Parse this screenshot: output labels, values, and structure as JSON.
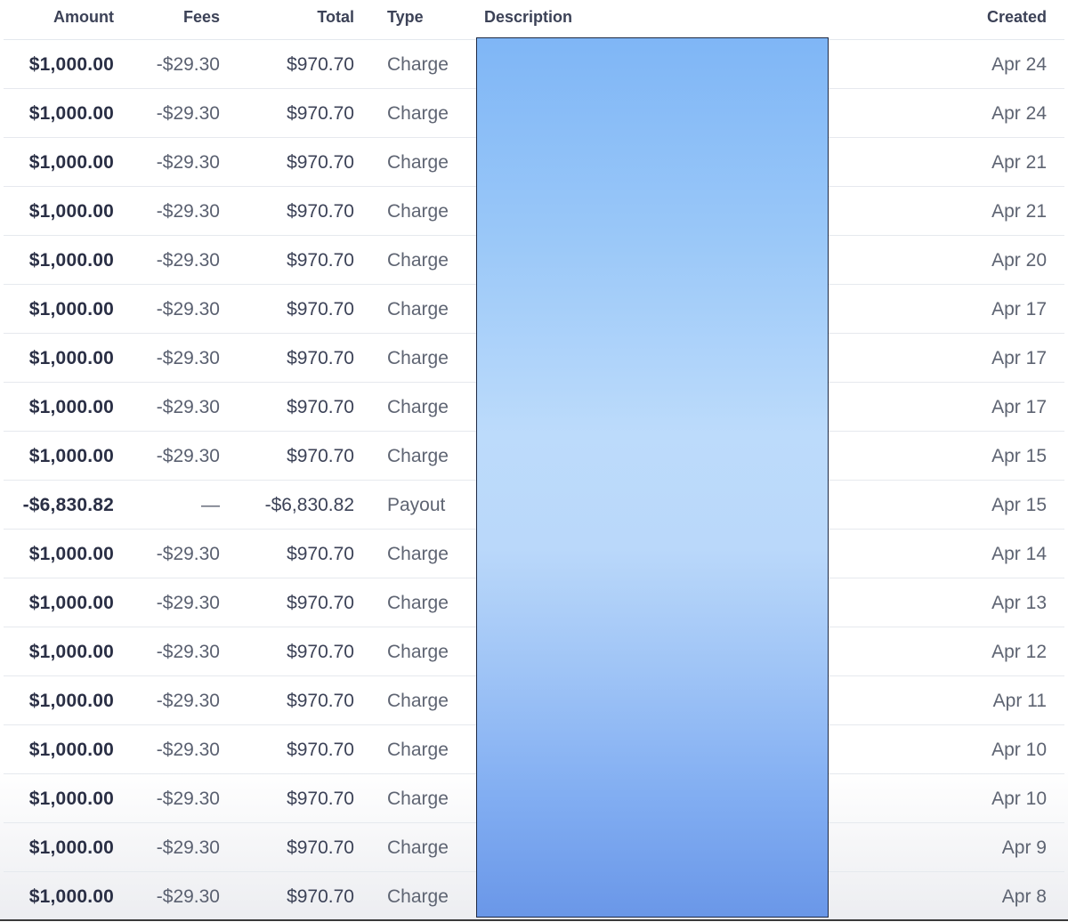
{
  "columns": {
    "amount": "Amount",
    "fees": "Fees",
    "total": "Total",
    "type": "Type",
    "description": "Description",
    "created": "Created"
  },
  "rows": [
    {
      "amount": "$1,000.00",
      "fees": "-$29.30",
      "total": "$970.70",
      "type": "Charge",
      "created": "Apr 24"
    },
    {
      "amount": "$1,000.00",
      "fees": "-$29.30",
      "total": "$970.70",
      "type": "Charge",
      "created": "Apr 24"
    },
    {
      "amount": "$1,000.00",
      "fees": "-$29.30",
      "total": "$970.70",
      "type": "Charge",
      "created": "Apr 21"
    },
    {
      "amount": "$1,000.00",
      "fees": "-$29.30",
      "total": "$970.70",
      "type": "Charge",
      "created": "Apr 21"
    },
    {
      "amount": "$1,000.00",
      "fees": "-$29.30",
      "total": "$970.70",
      "type": "Charge",
      "created": "Apr 20"
    },
    {
      "amount": "$1,000.00",
      "fees": "-$29.30",
      "total": "$970.70",
      "type": "Charge",
      "created": "Apr 17"
    },
    {
      "amount": "$1,000.00",
      "fees": "-$29.30",
      "total": "$970.70",
      "type": "Charge",
      "created": "Apr 17"
    },
    {
      "amount": "$1,000.00",
      "fees": "-$29.30",
      "total": "$970.70",
      "type": "Charge",
      "created": "Apr 17"
    },
    {
      "amount": "$1,000.00",
      "fees": "-$29.30",
      "total": "$970.70",
      "type": "Charge",
      "created": "Apr 15"
    },
    {
      "amount": "-$6,830.82",
      "fees": "—",
      "total": "-$6,830.82",
      "type": "Payout",
      "created": "Apr 15"
    },
    {
      "amount": "$1,000.00",
      "fees": "-$29.30",
      "total": "$970.70",
      "type": "Charge",
      "created": "Apr 14"
    },
    {
      "amount": "$1,000.00",
      "fees": "-$29.30",
      "total": "$970.70",
      "type": "Charge",
      "created": "Apr 13"
    },
    {
      "amount": "$1,000.00",
      "fees": "-$29.30",
      "total": "$970.70",
      "type": "Charge",
      "created": "Apr 12"
    },
    {
      "amount": "$1,000.00",
      "fees": "-$29.30",
      "total": "$970.70",
      "type": "Charge",
      "created": "Apr 11"
    },
    {
      "amount": "$1,000.00",
      "fees": "-$29.30",
      "total": "$970.70",
      "type": "Charge",
      "created": "Apr 10"
    },
    {
      "amount": "$1,000.00",
      "fees": "-$29.30",
      "total": "$970.70",
      "type": "Charge",
      "created": "Apr 10"
    },
    {
      "amount": "$1,000.00",
      "fees": "-$29.30",
      "total": "$970.70",
      "type": "Charge",
      "created": "Apr 9"
    },
    {
      "amount": "$1,000.00",
      "fees": "-$29.30",
      "total": "$970.70",
      "type": "Charge",
      "created": "Apr 8"
    }
  ],
  "colors": {
    "redaction_top": "#7fb6f6",
    "redaction_mid": "#bcdbfb",
    "redaction_bottom": "#6a97e8",
    "text_strong": "#2a2f45",
    "text_muted": "#5e6472",
    "row_border": "#e6e9ee"
  }
}
